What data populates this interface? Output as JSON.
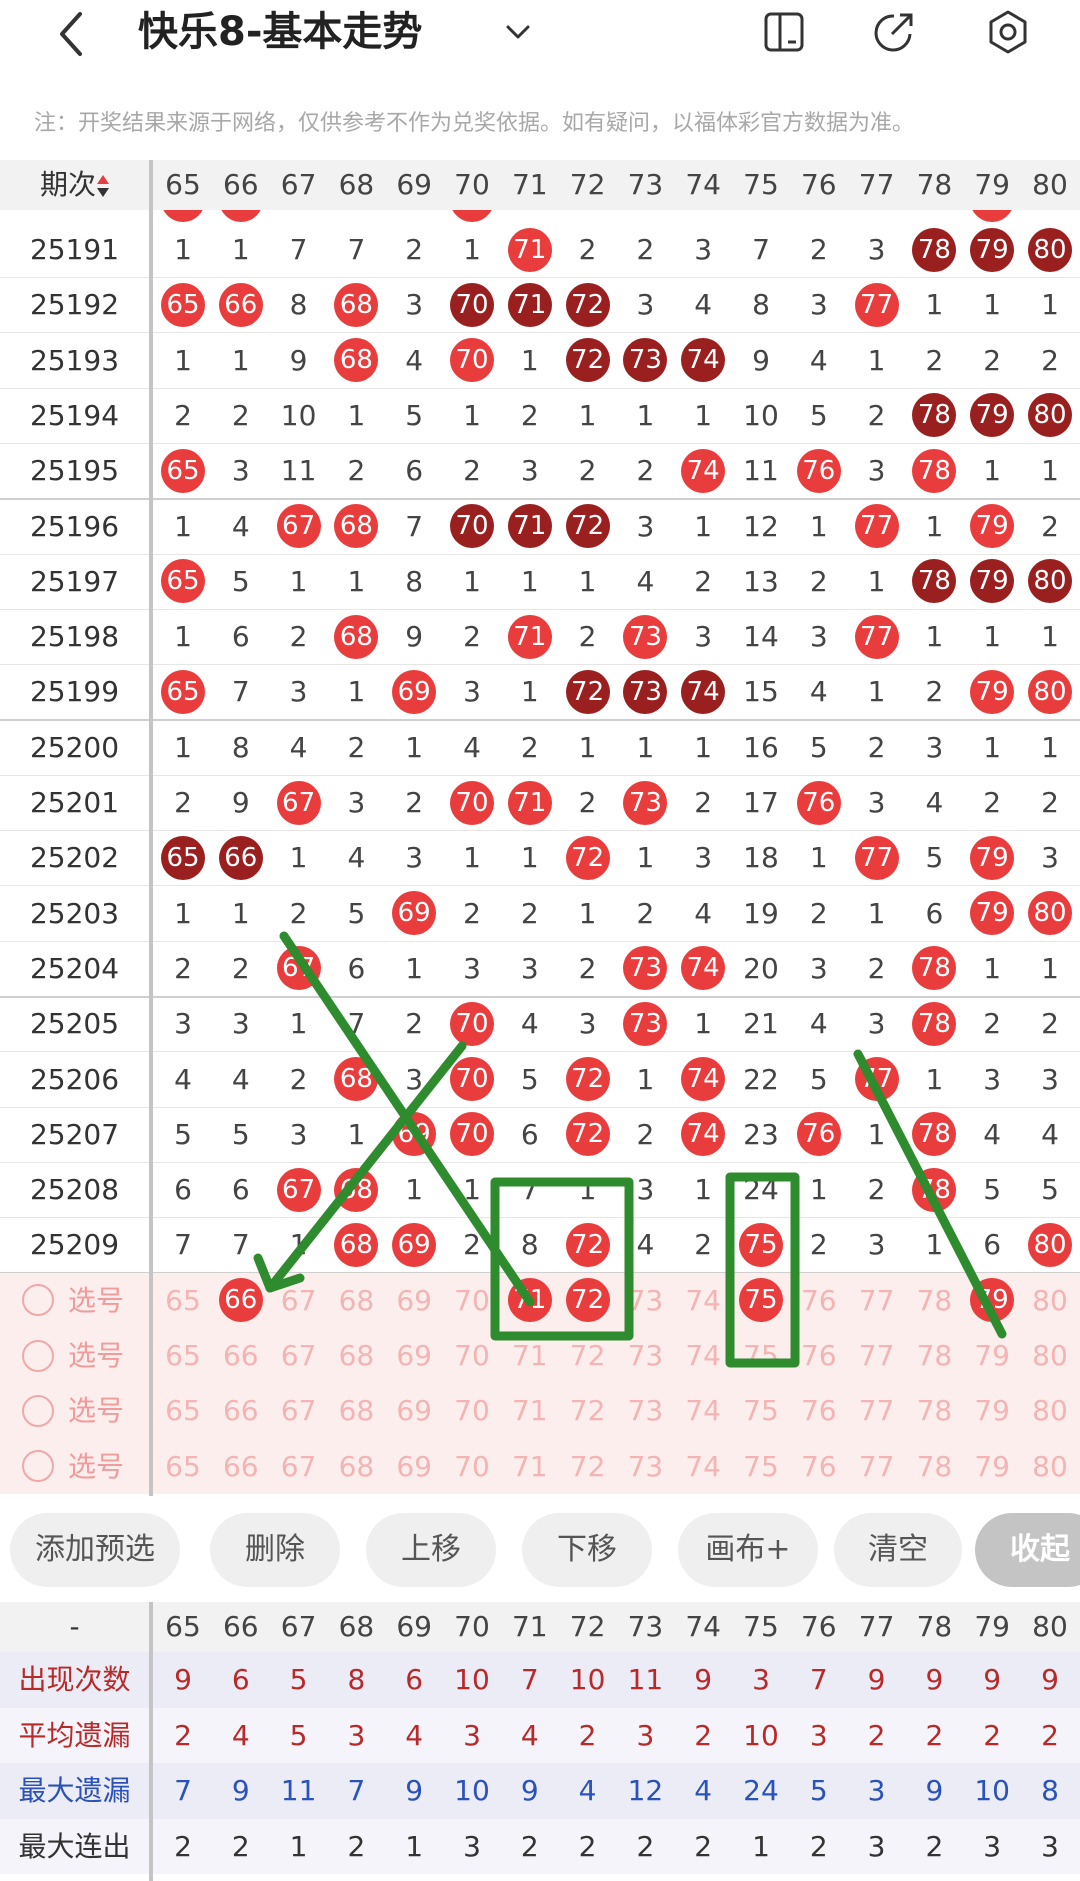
{
  "header": {
    "title": "快乐8-基本走势"
  },
  "note": "注：开奖结果来源于网络，仅供参考不作为兑奖依据。如有疑问，以福体彩官方数据为准。",
  "table": {
    "period_label": "期次",
    "columns": [
      "65",
      "66",
      "67",
      "68",
      "69",
      "70",
      "71",
      "72",
      "73",
      "74",
      "75",
      "76",
      "77",
      "78",
      "79",
      "80"
    ],
    "rows": [
      {
        "period": "25191",
        "cells": [
          "1",
          "1",
          "7",
          "7",
          "2",
          "1",
          "71",
          "2",
          "2",
          "3",
          "7",
          "2",
          "3",
          "78",
          "79",
          "80"
        ],
        "marks": [
          "",
          "",
          "",
          "",
          "",
          "",
          "r",
          "",
          "",
          "",
          "",
          "",
          "",
          "d",
          "d",
          "d"
        ]
      },
      {
        "period": "25192",
        "cells": [
          "65",
          "66",
          "8",
          "68",
          "3",
          "70",
          "71",
          "72",
          "3",
          "4",
          "8",
          "3",
          "77",
          "1",
          "1",
          "1"
        ],
        "marks": [
          "r",
          "r",
          "",
          "r",
          "",
          "d",
          "d",
          "d",
          "",
          "",
          "",
          "",
          "r",
          "",
          "",
          ""
        ]
      },
      {
        "period": "25193",
        "cells": [
          "1",
          "1",
          "9",
          "68",
          "4",
          "70",
          "1",
          "72",
          "73",
          "74",
          "9",
          "4",
          "1",
          "2",
          "2",
          "2"
        ],
        "marks": [
          "",
          "",
          "",
          "r",
          "",
          "r",
          "",
          "d",
          "d",
          "d",
          "",
          "",
          "",
          "",
          "",
          ""
        ]
      },
      {
        "period": "25194",
        "cells": [
          "2",
          "2",
          "10",
          "1",
          "5",
          "1",
          "2",
          "1",
          "1",
          "1",
          "10",
          "5",
          "2",
          "78",
          "79",
          "80"
        ],
        "marks": [
          "",
          "",
          "",
          "",
          "",
          "",
          "",
          "",
          "",
          "",
          "",
          "",
          "",
          "d",
          "d",
          "d"
        ]
      },
      {
        "period": "25195",
        "cells": [
          "65",
          "3",
          "11",
          "2",
          "6",
          "2",
          "3",
          "2",
          "2",
          "74",
          "11",
          "76",
          "3",
          "78",
          "1",
          "1"
        ],
        "marks": [
          "r",
          "",
          "",
          "",
          "",
          "",
          "",
          "",
          "",
          "r",
          "",
          "r",
          "",
          "r",
          "",
          ""
        ]
      },
      {
        "period": "25196",
        "cells": [
          "1",
          "4",
          "67",
          "68",
          "7",
          "70",
          "71",
          "72",
          "3",
          "1",
          "12",
          "1",
          "77",
          "1",
          "79",
          "2"
        ],
        "marks": [
          "",
          "",
          "r",
          "r",
          "",
          "d",
          "d",
          "d",
          "",
          "",
          "",
          "",
          "r",
          "",
          "r",
          ""
        ]
      },
      {
        "period": "25197",
        "cells": [
          "65",
          "5",
          "1",
          "1",
          "8",
          "1",
          "1",
          "1",
          "4",
          "2",
          "13",
          "2",
          "1",
          "78",
          "79",
          "80"
        ],
        "marks": [
          "r",
          "",
          "",
          "",
          "",
          "",
          "",
          "",
          "",
          "",
          "",
          "",
          "",
          "d",
          "d",
          "d"
        ]
      },
      {
        "period": "25198",
        "cells": [
          "1",
          "6",
          "2",
          "68",
          "9",
          "2",
          "71",
          "2",
          "73",
          "3",
          "14",
          "3",
          "77",
          "1",
          "1",
          "1"
        ],
        "marks": [
          "",
          "",
          "",
          "r",
          "",
          "",
          "r",
          "",
          "r",
          "",
          "",
          "",
          "r",
          "",
          "",
          ""
        ]
      },
      {
        "period": "25199",
        "cells": [
          "65",
          "7",
          "3",
          "1",
          "69",
          "3",
          "1",
          "72",
          "73",
          "74",
          "15",
          "4",
          "1",
          "2",
          "79",
          "80"
        ],
        "marks": [
          "r",
          "",
          "",
          "",
          "r",
          "",
          "",
          "d",
          "d",
          "d",
          "",
          "",
          "",
          "",
          "r",
          "r"
        ]
      },
      {
        "period": "25200",
        "cells": [
          "1",
          "8",
          "4",
          "2",
          "1",
          "4",
          "2",
          "1",
          "1",
          "1",
          "16",
          "5",
          "2",
          "3",
          "1",
          "1"
        ],
        "marks": [
          "",
          "",
          "",
          "",
          "",
          "",
          "",
          "",
          "",
          "",
          "",
          "",
          "",
          "",
          "",
          ""
        ]
      },
      {
        "period": "25201",
        "cells": [
          "2",
          "9",
          "67",
          "3",
          "2",
          "70",
          "71",
          "2",
          "73",
          "2",
          "17",
          "76",
          "3",
          "4",
          "2",
          "2"
        ],
        "marks": [
          "",
          "",
          "r",
          "",
          "",
          "r",
          "r",
          "",
          "r",
          "",
          "",
          "r",
          "",
          "",
          "",
          ""
        ]
      },
      {
        "period": "25202",
        "cells": [
          "65",
          "66",
          "1",
          "4",
          "3",
          "1",
          "1",
          "72",
          "1",
          "3",
          "18",
          "1",
          "77",
          "5",
          "79",
          "3"
        ],
        "marks": [
          "d",
          "d",
          "",
          "",
          "",
          "",
          "",
          "r",
          "",
          "",
          "",
          "",
          "r",
          "",
          "r",
          ""
        ]
      },
      {
        "period": "25203",
        "cells": [
          "1",
          "1",
          "2",
          "5",
          "69",
          "2",
          "2",
          "1",
          "2",
          "4",
          "19",
          "2",
          "1",
          "6",
          "79",
          "80"
        ],
        "marks": [
          "",
          "",
          "",
          "",
          "r",
          "",
          "",
          "",
          "",
          "",
          "",
          "",
          "",
          "",
          "r",
          "r"
        ]
      },
      {
        "period": "25204",
        "cells": [
          "2",
          "2",
          "67",
          "6",
          "1",
          "3",
          "3",
          "2",
          "73",
          "74",
          "20",
          "3",
          "2",
          "78",
          "1",
          "1"
        ],
        "marks": [
          "",
          "",
          "r",
          "",
          "",
          "",
          "",
          "",
          "r",
          "r",
          "",
          "",
          "",
          "r",
          "",
          ""
        ]
      },
      {
        "period": "25205",
        "cells": [
          "3",
          "3",
          "1",
          "7",
          "2",
          "70",
          "4",
          "3",
          "73",
          "1",
          "21",
          "4",
          "3",
          "78",
          "2",
          "2"
        ],
        "marks": [
          "",
          "",
          "",
          "",
          "",
          "r",
          "",
          "",
          "r",
          "",
          "",
          "",
          "",
          "r",
          "",
          ""
        ]
      },
      {
        "period": "25206",
        "cells": [
          "4",
          "4",
          "2",
          "68",
          "3",
          "70",
          "5",
          "72",
          "1",
          "74",
          "22",
          "5",
          "77",
          "1",
          "3",
          "3"
        ],
        "marks": [
          "",
          "",
          "",
          "r",
          "",
          "r",
          "",
          "r",
          "",
          "r",
          "",
          "",
          "r",
          "",
          "",
          ""
        ]
      },
      {
        "period": "25207",
        "cells": [
          "5",
          "5",
          "3",
          "1",
          "69",
          "70",
          "6",
          "72",
          "2",
          "74",
          "23",
          "76",
          "1",
          "78",
          "4",
          "4"
        ],
        "marks": [
          "",
          "",
          "",
          "",
          "r",
          "r",
          "",
          "r",
          "",
          "r",
          "",
          "r",
          "",
          "r",
          "",
          ""
        ]
      },
      {
        "period": "25208",
        "cells": [
          "6",
          "6",
          "67",
          "68",
          "1",
          "1",
          "7",
          "1",
          "3",
          "1",
          "24",
          "1",
          "2",
          "78",
          "5",
          "5"
        ],
        "marks": [
          "",
          "",
          "r",
          "r",
          "",
          "",
          "",
          "",
          "",
          "",
          "",
          "",
          "",
          "r",
          "",
          ""
        ]
      },
      {
        "period": "25209",
        "cells": [
          "7",
          "7",
          "1",
          "68",
          "69",
          "2",
          "8",
          "72",
          "4",
          "2",
          "75",
          "2",
          "3",
          "1",
          "6",
          "80"
        ],
        "marks": [
          "",
          "",
          "",
          "r",
          "r",
          "",
          "",
          "r",
          "",
          "",
          "r",
          "",
          "",
          "",
          "",
          "r"
        ]
      }
    ],
    "select_rows": [
      {
        "label": "选号",
        "picked": [
          "66",
          "71",
          "72",
          "75",
          "79"
        ]
      },
      {
        "label": "选号",
        "picked": []
      },
      {
        "label": "选号",
        "picked": []
      },
      {
        "label": "选号",
        "picked": []
      }
    ]
  },
  "buttons": {
    "add": "添加预选",
    "delete": "删除",
    "up": "上移",
    "down": "下移",
    "canvas": "画布+",
    "clear": "清空",
    "collapse": "收起"
  },
  "stats": {
    "dash": "-",
    "rows": [
      {
        "label": "出现次数",
        "color": "#b82a2a",
        "values": [
          "9",
          "6",
          "5",
          "8",
          "6",
          "10",
          "7",
          "10",
          "11",
          "9",
          "3",
          "7",
          "9",
          "9",
          "9",
          "9"
        ]
      },
      {
        "label": "平均遗漏",
        "color": "#b82a2a",
        "values": [
          "2",
          "4",
          "5",
          "3",
          "4",
          "3",
          "4",
          "2",
          "3",
          "2",
          "10",
          "3",
          "2",
          "2",
          "2",
          "2"
        ]
      },
      {
        "label": "最大遗漏",
        "color": "#2a52b8",
        "values": [
          "7",
          "9",
          "11",
          "7",
          "9",
          "10",
          "9",
          "4",
          "12",
          "4",
          "24",
          "5",
          "3",
          "9",
          "10",
          "8"
        ]
      },
      {
        "label": "最大连出",
        "color": "#333333",
        "values": [
          "2",
          "2",
          "1",
          "2",
          "1",
          "3",
          "2",
          "2",
          "2",
          "2",
          "1",
          "2",
          "3",
          "2",
          "3",
          "3"
        ]
      }
    ]
  },
  "colors": {
    "red": "#e93c3c",
    "dark": "#9a1f1f",
    "annotation": "#2e8b2e"
  }
}
